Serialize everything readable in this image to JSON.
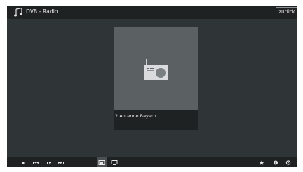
{
  "header": {
    "title": "DVB - Radio",
    "back_label": "zurück"
  },
  "station": {
    "name": "2 Antenne Bayern"
  },
  "controls": {
    "left": [
      "stop-icon",
      "previous-track-icon",
      "play-pause-icon",
      "next-track-icon"
    ],
    "view": [
      "grid-view-icon",
      "list-view-icon"
    ],
    "right": [
      "favorite-star-icon",
      "info-icon",
      "settings-icon"
    ]
  },
  "colors": {
    "background": "#2f3436",
    "bar": "#1e2223",
    "tile": "#5b6063",
    "caption": "#1f2223",
    "radio_body": "#d9dbdc"
  }
}
